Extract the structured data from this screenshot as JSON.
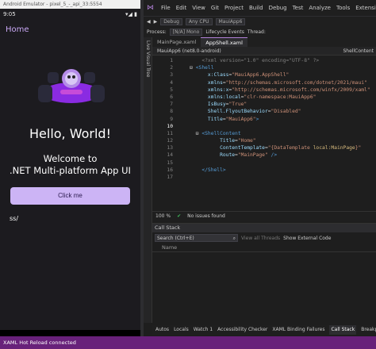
{
  "emulator": {
    "title": "Android Emulator - pixel_5_-_api_33:5554",
    "status_time": "9:05",
    "status_right": "▾◢ ▮",
    "nav_title": "Home",
    "hello": "Hello, World!",
    "welcome_line1": "Welcome to",
    "welcome_line2": ".NET Multi-platform App UI",
    "button": "Click me",
    "ss_text": "ss/",
    "nav_buttons": [
      "◀",
      "●",
      "■"
    ]
  },
  "vs": {
    "menu": [
      "File",
      "Edit",
      "View",
      "Git",
      "Project",
      "Build",
      "Debug",
      "Test",
      "Analyze",
      "Tools",
      "Extensions"
    ],
    "toolbar_items": [
      "Debug",
      "Any CPU",
      "MauiApp6"
    ],
    "toolbar2": {
      "process_label": "Process:",
      "process_value": "[N/A] Mono",
      "lifecycle": "Lifecycle Events",
      "thread": "Thread:"
    },
    "live_tree": "Live Visual Tree",
    "tabs": [
      "MainPage.xaml",
      "AppShell.xaml"
    ],
    "nav_left": "MauiApp6 (net8.0-android)",
    "nav_right": "ShellContent",
    "lines": [
      {
        "n": "1",
        "segs": [
          [
            "c-gr",
            "        <?xml version=\"1.0\" encoding=\"UTF-8\" ?>"
          ]
        ]
      },
      {
        "n": "2",
        "segs": [
          [
            "c-pl",
            "    ⊟ "
          ],
          [
            "c-tg",
            "<Shell"
          ]
        ]
      },
      {
        "n": "3",
        "segs": [
          [
            "c-at",
            "          x:Class"
          ],
          [
            "c-pl",
            "="
          ],
          [
            "c-st",
            "\"MauiApp6.AppShell\""
          ]
        ]
      },
      {
        "n": "4",
        "segs": [
          [
            "c-at",
            "          xmlns"
          ],
          [
            "c-pl",
            "="
          ],
          [
            "c-st",
            "\"http://schemas.microsoft.com/dotnet/2021/maui\""
          ]
        ]
      },
      {
        "n": "5",
        "segs": [
          [
            "c-at",
            "          xmlns:x"
          ],
          [
            "c-pl",
            "="
          ],
          [
            "c-st",
            "\"http://schemas.microsoft.com/winfx/2009/xaml\""
          ]
        ]
      },
      {
        "n": "6",
        "segs": [
          [
            "c-at",
            "          xmlns:local"
          ],
          [
            "c-pl",
            "="
          ],
          [
            "c-st",
            "\"clr-namespace:MauiApp6\""
          ]
        ]
      },
      {
        "n": "7",
        "segs": [
          [
            "c-at",
            "          IsBusy"
          ],
          [
            "c-pl",
            "="
          ],
          [
            "c-st",
            "\"True\""
          ]
        ]
      },
      {
        "n": "8",
        "segs": [
          [
            "c-at",
            "          Shell.FlyoutBehavior"
          ],
          [
            "c-pl",
            "="
          ],
          [
            "c-st",
            "\"Disabled\""
          ]
        ]
      },
      {
        "n": "9",
        "segs": [
          [
            "c-at",
            "          Title"
          ],
          [
            "c-pl",
            "="
          ],
          [
            "c-st",
            "\"MauiApp6\""
          ],
          [
            "c-tg",
            ">"
          ]
        ]
      },
      {
        "n": "10",
        "segs": [
          [
            "c-pl",
            ""
          ]
        ]
      },
      {
        "n": "11",
        "segs": [
          [
            "c-pl",
            "      ⊟ "
          ],
          [
            "c-tg",
            "<ShellContent"
          ]
        ]
      },
      {
        "n": "12",
        "segs": [
          [
            "c-at",
            "              Title"
          ],
          [
            "c-pl",
            "="
          ],
          [
            "c-st",
            "\"Home\""
          ]
        ]
      },
      {
        "n": "13",
        "segs": [
          [
            "c-at",
            "              ContentTemplate"
          ],
          [
            "c-pl",
            "="
          ],
          [
            "c-st",
            "\"{DataTemplate "
          ],
          [
            "c-ex",
            "local:MainPage"
          ],
          [
            "c-st",
            "}\""
          ]
        ]
      },
      {
        "n": "14",
        "segs": [
          [
            "c-at",
            "              Route"
          ],
          [
            "c-pl",
            "="
          ],
          [
            "c-st",
            "\"MainPage\""
          ],
          [
            "c-tg",
            " />"
          ]
        ]
      },
      {
        "n": "15",
        "segs": [
          [
            "c-pl",
            ""
          ]
        ]
      },
      {
        "n": "16",
        "segs": [
          [
            "c-pl",
            "        "
          ],
          [
            "c-tg",
            "</Shell>"
          ]
        ]
      },
      {
        "n": "17",
        "segs": [
          [
            "c-pl",
            ""
          ]
        ]
      }
    ],
    "zoom": "100 %",
    "no_issues": "No issues found",
    "call_stack_title": "Call Stack",
    "search_placeholder": "Search (Ctrl+E)",
    "show_all_threads": "View all Threads",
    "show_external": "Show External Code",
    "name_col": "Name",
    "bottom_tabs": [
      "Autos",
      "Locals",
      "Watch 1",
      "Accessibility Checker",
      "XAML Binding Failures",
      "Call Stack",
      "Breakpoints"
    ],
    "status": "XAML Hot Reload connected"
  }
}
